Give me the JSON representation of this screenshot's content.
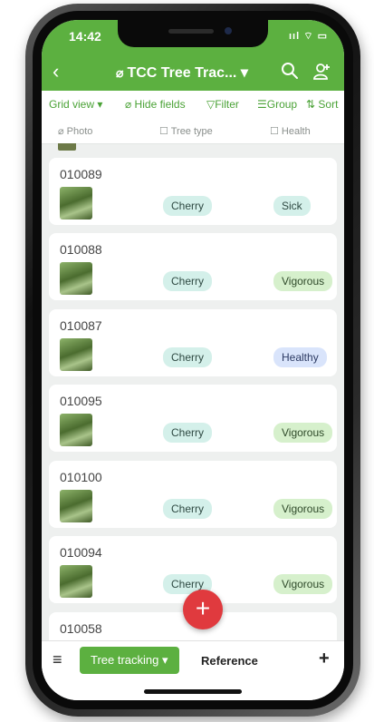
{
  "status": {
    "time": "14:42",
    "signal": "ııl ⌔ ▭"
  },
  "nav": {
    "back": "‹",
    "title": "TCC Tree Trac... ▾"
  },
  "toolbar": {
    "grid_view": "Grid view ▾",
    "hide_fields": "⌀ Hide fields",
    "filter": "▽Filter",
    "group": "☰Group",
    "sort": "⇅ Sort"
  },
  "columns": {
    "photo": "⌀ Photo",
    "tree_type": "☐ Tree type",
    "health": "☐ Health"
  },
  "rows": [
    {
      "id": "010089",
      "type": "Cherry",
      "health": "Sick"
    },
    {
      "id": "010088",
      "type": "Cherry",
      "health": "Vigorous"
    },
    {
      "id": "010087",
      "type": "Cherry",
      "health": "Healthy"
    },
    {
      "id": "010095",
      "type": "Cherry",
      "health": "Vigorous"
    },
    {
      "id": "010100",
      "type": "Cherry",
      "health": "Vigorous"
    },
    {
      "id": "010094",
      "type": "Cherry",
      "health": "Vigorous"
    },
    {
      "id": "010058"
    }
  ],
  "fab": {
    "label": "+"
  },
  "bottom": {
    "menu": "≡",
    "active_tab": "Tree tracking ▾",
    "reference_tab": "Reference",
    "add": "+"
  },
  "colors": {
    "primary_green": "#5cb040",
    "fab_red": "#e03a3e",
    "tag_teal": "#d4f0ea",
    "tag_green": "#d6f0cc",
    "tag_blue": "#d9e4fb"
  }
}
